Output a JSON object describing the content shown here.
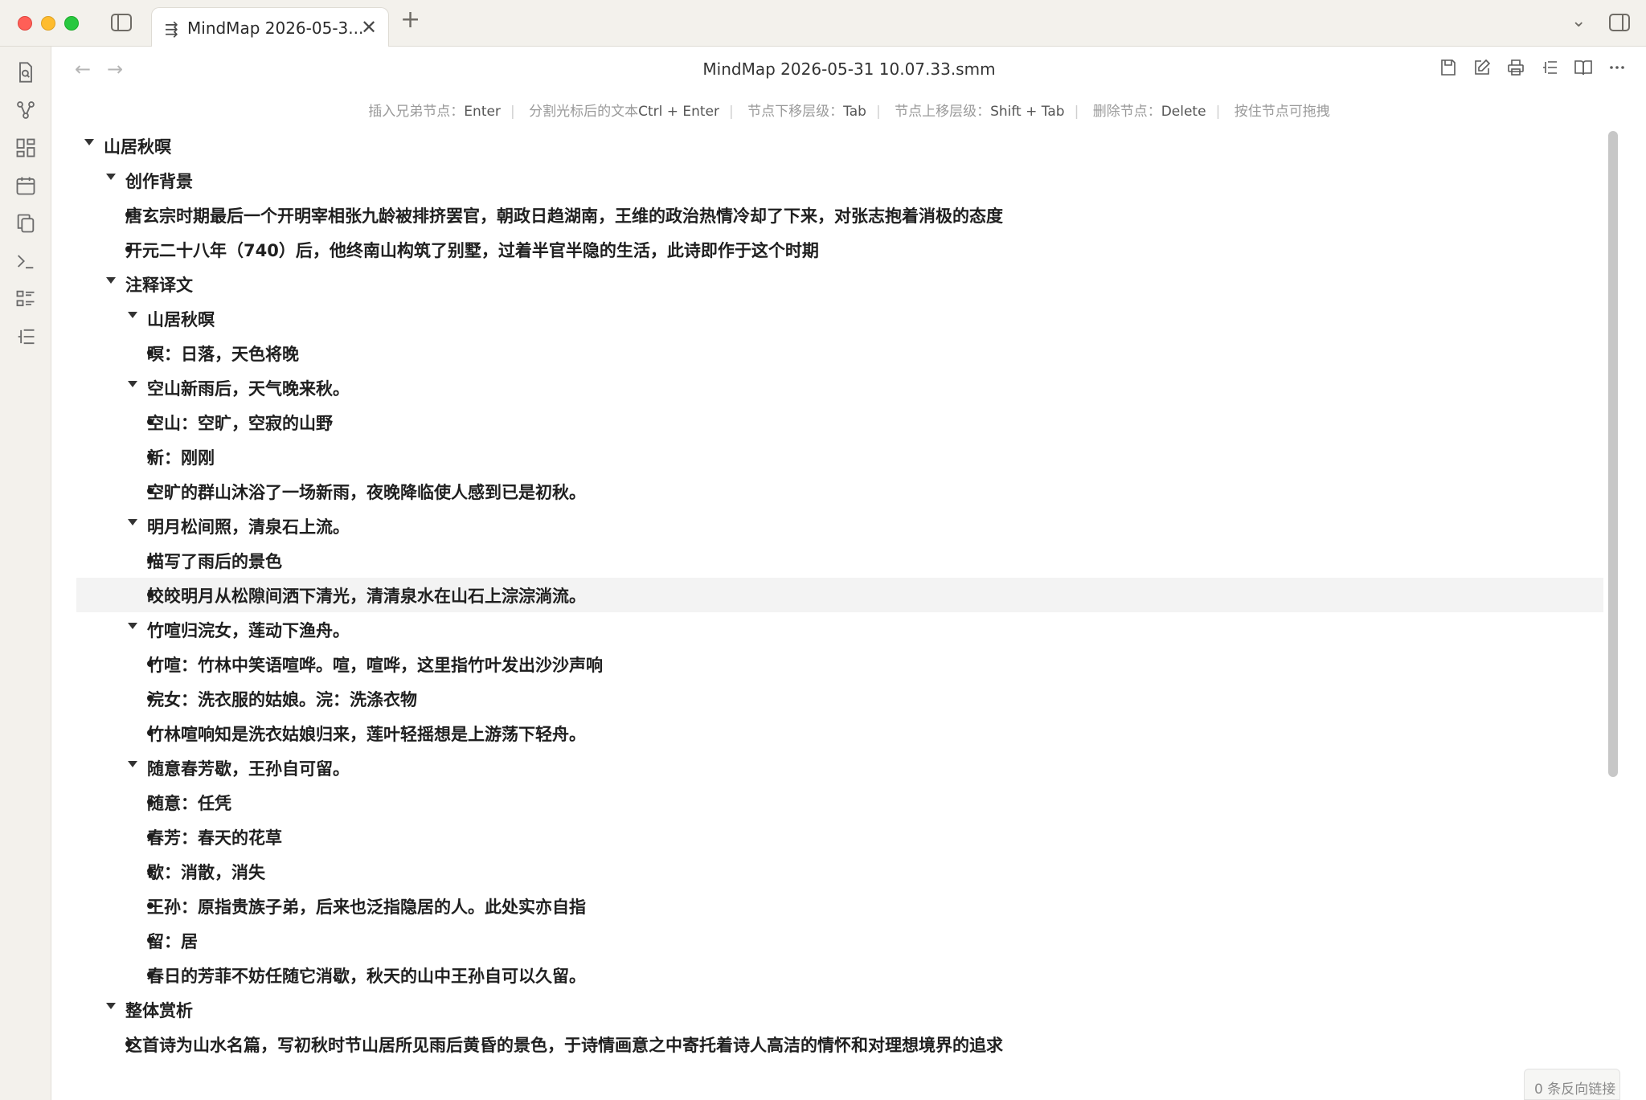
{
  "tab": {
    "title": "MindMap 2026-05-3..."
  },
  "view": {
    "title": "MindMap 2026-05-31 10.07.33.smm",
    "back_icon": "←",
    "forward_icon": "→"
  },
  "hints": [
    {
      "label": "插入兄弟节点：",
      "key": "Enter"
    },
    {
      "label": "分割光标后的文本",
      "key": "Ctrl + Enter"
    },
    {
      "label": "节点下移层级：",
      "key": "Tab"
    },
    {
      "label": "节点上移层级：",
      "key": "Shift + Tab"
    },
    {
      "label": "删除节点：",
      "key": "Delete"
    },
    {
      "label": "按住节点可拖拽",
      "key": ""
    }
  ],
  "outline": [
    {
      "text": "山居秋暝",
      "level": 0,
      "kind": "caret"
    },
    {
      "text": "创作背景",
      "level": 1,
      "kind": "caret"
    },
    {
      "text": "唐玄宗时期最后一个开明宰相张九龄被排挤罢官，朝政日趋湖南，王维的政治热情冷却了下来，对张志抱着消极的态度",
      "level": 2,
      "kind": "bullet"
    },
    {
      "text": "开元二十八年（740）后，他终南山构筑了别墅，过着半官半隐的生活，此诗即作于这个时期",
      "level": 2,
      "kind": "bullet"
    },
    {
      "text": "注释译文",
      "level": 1,
      "kind": "caret"
    },
    {
      "text": "山居秋暝",
      "level": 2,
      "kind": "caret"
    },
    {
      "text": "暝：日落，天色将晚",
      "level": 3,
      "kind": "bullet"
    },
    {
      "text": "空山新雨后，天气晚来秋。",
      "level": 2,
      "kind": "caret"
    },
    {
      "text": "空山：空旷，空寂的山野",
      "level": 3,
      "kind": "bullet"
    },
    {
      "text": "新：刚刚",
      "level": 3,
      "kind": "bullet"
    },
    {
      "text": "空旷的群山沐浴了一场新雨，夜晚降临使人感到已是初秋。",
      "level": 3,
      "kind": "bullet"
    },
    {
      "text": "明月松间照，清泉石上流。",
      "level": 2,
      "kind": "caret"
    },
    {
      "text": "描写了雨后的景色",
      "level": 3,
      "kind": "bullet"
    },
    {
      "text": "皎皎明月从松隙间洒下清光，清清泉水在山石上淙淙淌流。",
      "level": 3,
      "kind": "bullet",
      "highlight": true
    },
    {
      "text": "竹喧归浣女，莲动下渔舟。",
      "level": 2,
      "kind": "caret"
    },
    {
      "text": "竹喧：竹林中笑语喧哗。喧，喧哗，这里指竹叶发出沙沙声响",
      "level": 3,
      "kind": "bullet"
    },
    {
      "text": "浣女：洗衣服的姑娘。浣：洗涤衣物",
      "level": 3,
      "kind": "bullet"
    },
    {
      "text": "竹林喧响知是洗衣姑娘归来，莲叶轻摇想是上游荡下轻舟。",
      "level": 3,
      "kind": "bullet"
    },
    {
      "text": "随意春芳歇，王孙自可留。",
      "level": 2,
      "kind": "caret"
    },
    {
      "text": "随意：任凭",
      "level": 3,
      "kind": "bullet"
    },
    {
      "text": "春芳：春天的花草",
      "level": 3,
      "kind": "bullet"
    },
    {
      "text": "歇：消散，消失",
      "level": 3,
      "kind": "bullet"
    },
    {
      "text": "王孙：原指贵族子弟，后来也泛指隐居的人。此处实亦自指",
      "level": 3,
      "kind": "bullet"
    },
    {
      "text": "留：居",
      "level": 3,
      "kind": "bullet"
    },
    {
      "text": "春日的芳菲不妨任随它消歇，秋天的山中王孙自可以久留。",
      "level": 3,
      "kind": "bullet"
    },
    {
      "text": "整体赏析",
      "level": 1,
      "kind": "caret"
    },
    {
      "text": "这首诗为山水名篇，写初秋时节山居所见雨后黄昏的景色，于诗情画意之中寄托着诗人高洁的情怀和对理想境界的追求",
      "level": 2,
      "kind": "bullet"
    }
  ],
  "status": {
    "backlinks": "0 条反向链接"
  },
  "icons": {
    "ribbon": [
      "file-search-icon",
      "graph-icon",
      "dashboard-icon",
      "calendar-icon",
      "copy-icon",
      "terminal-icon",
      "outline-icon",
      "mindmap-outline-icon"
    ],
    "actions": [
      "save-icon",
      "edit-icon",
      "print-icon",
      "outline-view-icon",
      "book-icon",
      "more-icon"
    ]
  }
}
